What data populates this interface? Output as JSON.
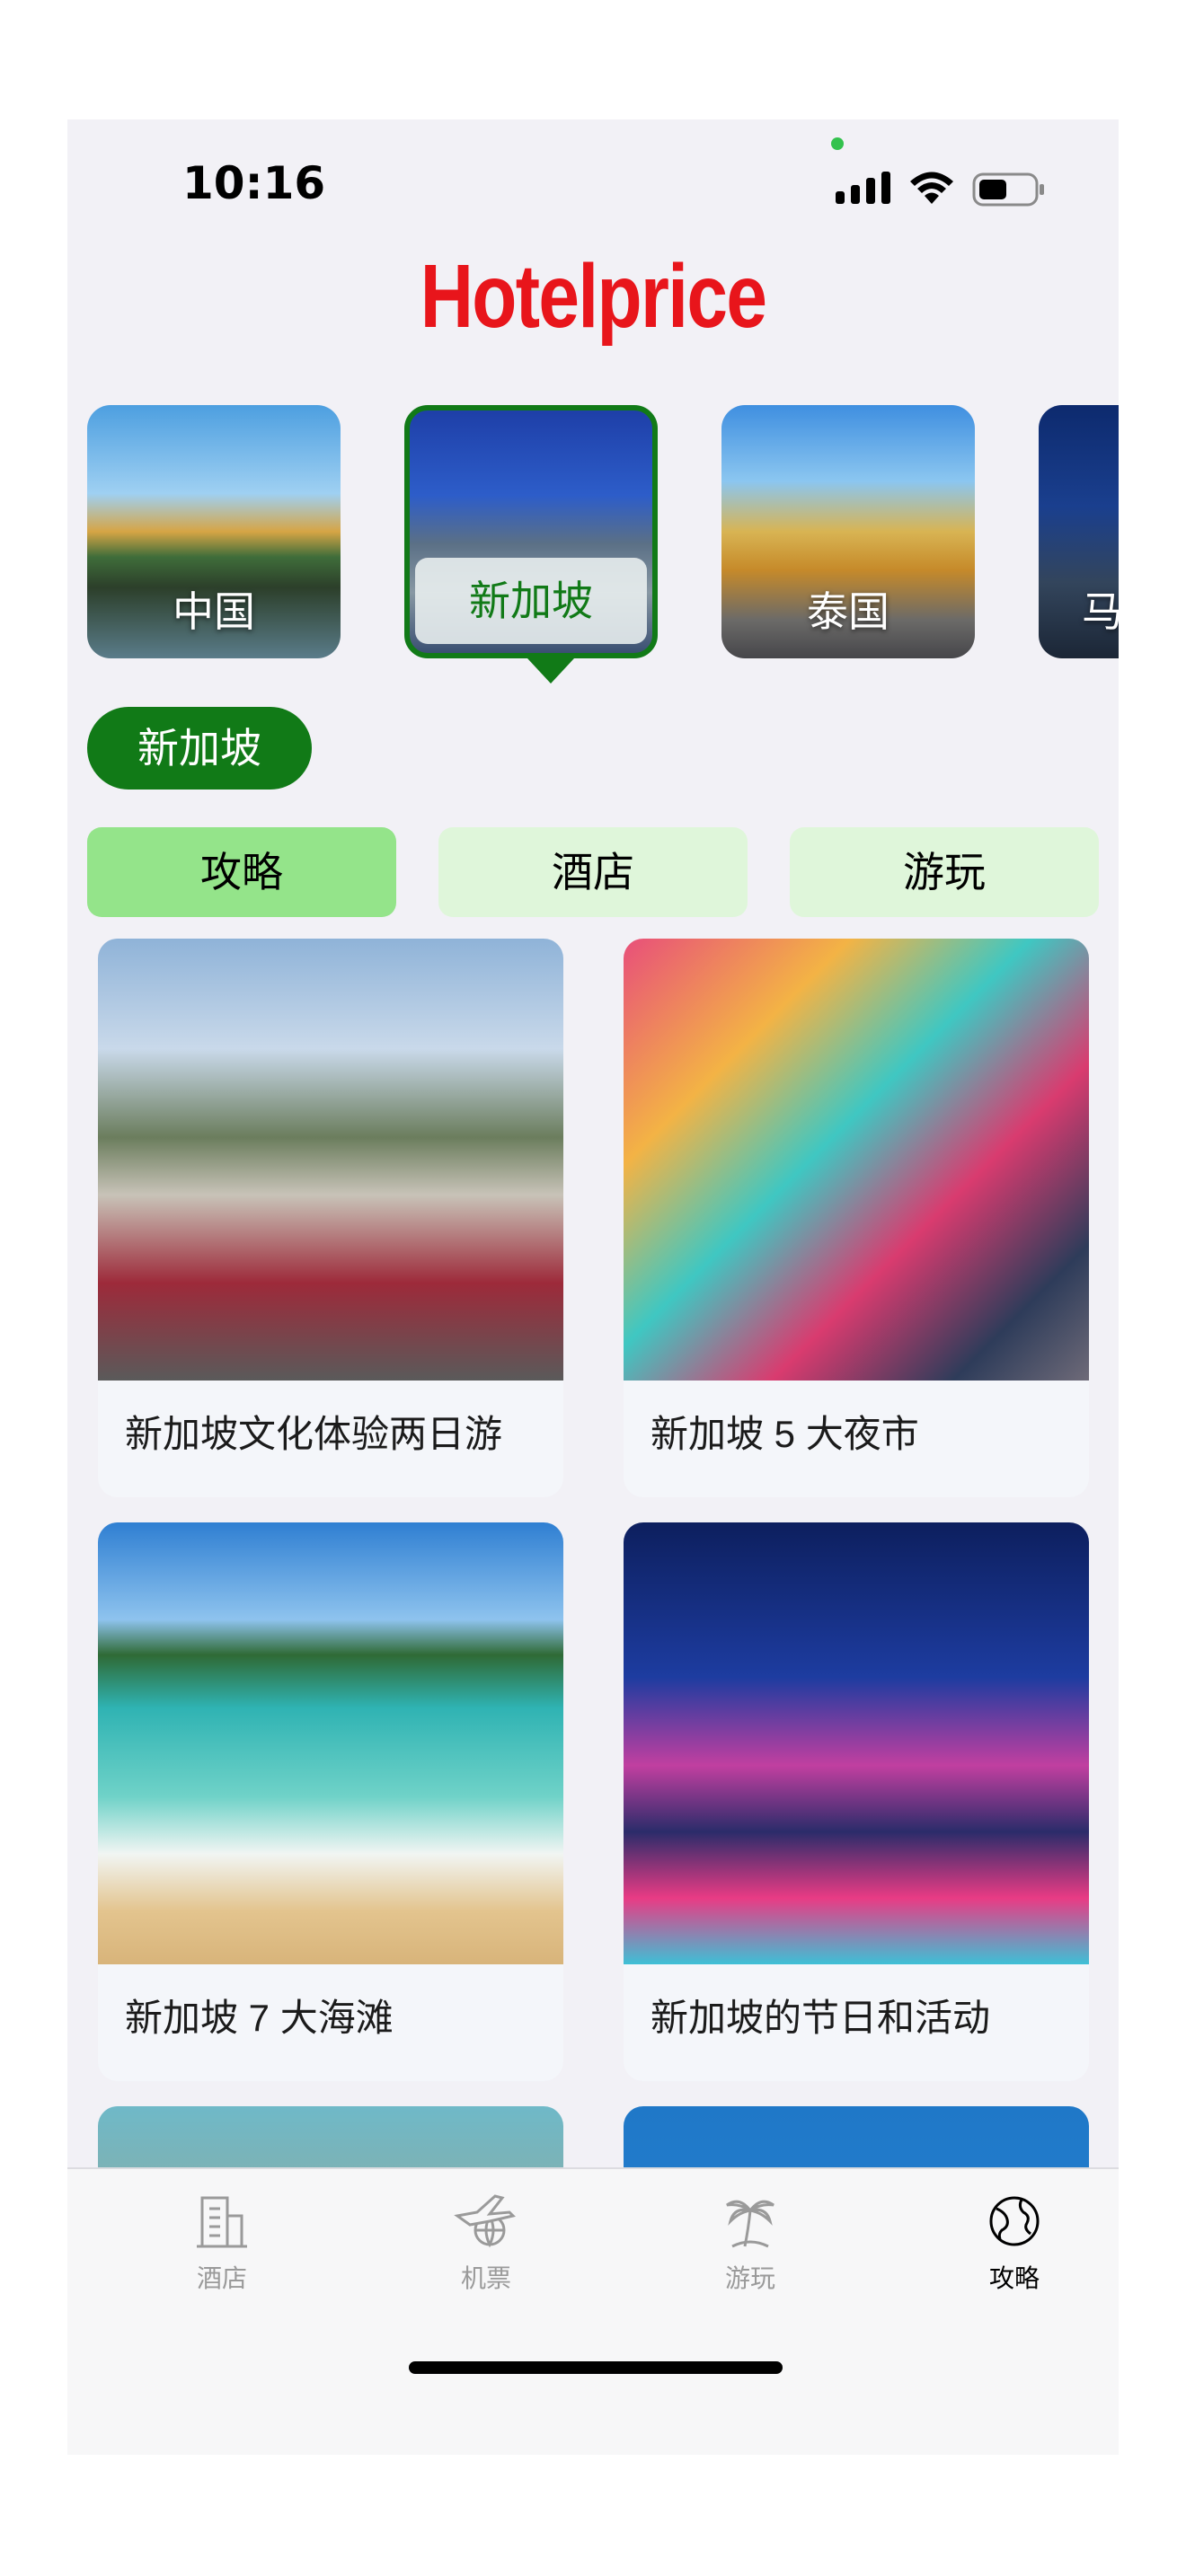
{
  "status": {
    "time": "10:16"
  },
  "brand": "Hotelprice",
  "destinations": [
    {
      "label": "中国",
      "selected": false
    },
    {
      "label": "新加坡",
      "selected": true
    },
    {
      "label": "泰国",
      "selected": false
    },
    {
      "label": "马",
      "selected": false
    }
  ],
  "selected_destination": "新加坡",
  "tabs": [
    {
      "label": "攻略",
      "active": true
    },
    {
      "label": "酒店",
      "active": false
    },
    {
      "label": "游玩",
      "active": false
    }
  ],
  "articles": [
    {
      "title": "新加坡文化体验两日游"
    },
    {
      "title": "新加坡 5 大夜市"
    },
    {
      "title": "新加坡 7 大海滩"
    },
    {
      "title": "新加坡的节日和活动"
    },
    {
      "title": ""
    },
    {
      "title": ""
    }
  ],
  "tabbar": [
    {
      "label": "酒店",
      "icon": "hotel-building-icon",
      "active": false
    },
    {
      "label": "机票",
      "icon": "airplane-globe-icon",
      "active": false
    },
    {
      "label": "游玩",
      "icon": "palm-tree-icon",
      "active": false
    },
    {
      "label": "攻略",
      "icon": "globe-icon",
      "active": true
    }
  ],
  "colors": {
    "brand_red": "#e8151b",
    "accent_green": "#117a17",
    "tab_active": "#94e48a",
    "tab_inactive": "#dff6da",
    "background": "#f2f1f6"
  }
}
